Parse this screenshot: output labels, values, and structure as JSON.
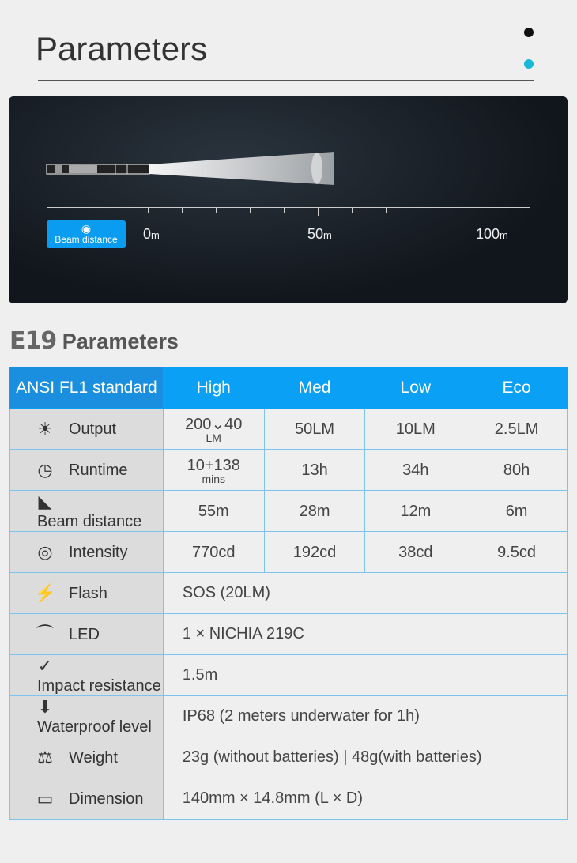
{
  "header": {
    "title": "Parameters",
    "dot_colors": [
      "#111111",
      "#1ab8d8"
    ]
  },
  "hero": {
    "badge_icon": "eye-icon",
    "badge_label": "Beam distance",
    "ticks": [
      "0",
      "50",
      "100"
    ],
    "unit": "m"
  },
  "section": {
    "model": "E19",
    "title": "Parameters"
  },
  "table": {
    "header": [
      "ANSI FL1 standard",
      "High",
      "Med",
      "Low",
      "Eco"
    ],
    "mode_rows": [
      {
        "icon": "output-icon",
        "label": "Output",
        "values": [
          {
            "main": "200⌄40",
            "sub": "LM"
          },
          {
            "main": "50LM"
          },
          {
            "main": "10LM"
          },
          {
            "main": "2.5LM"
          }
        ]
      },
      {
        "icon": "clock-icon",
        "label": "Runtime",
        "values": [
          {
            "main": "10+138",
            "sub": "mins"
          },
          {
            "main": "13h"
          },
          {
            "main": "34h"
          },
          {
            "main": "80h"
          }
        ]
      },
      {
        "icon": "beam-icon",
        "label": "Beam distance",
        "values": [
          {
            "main": "55m"
          },
          {
            "main": "28m"
          },
          {
            "main": "12m"
          },
          {
            "main": "6m"
          }
        ]
      },
      {
        "icon": "intensity-icon",
        "label": "Intensity",
        "values": [
          {
            "main": "770cd"
          },
          {
            "main": "192cd"
          },
          {
            "main": "38cd"
          },
          {
            "main": "9.5cd"
          }
        ]
      }
    ],
    "spec_rows": [
      {
        "icon": "flash-icon",
        "label": "Flash",
        "value": "SOS (20LM)"
      },
      {
        "icon": "led-icon",
        "label": "LED",
        "value": "1 × NICHIA 219C"
      },
      {
        "icon": "impact-icon",
        "label": "Impact resistance",
        "value": "1.5m"
      },
      {
        "icon": "waterproof-icon",
        "label": "Waterproof level",
        "value": "IP68 (2 meters underwater for 1h)"
      },
      {
        "icon": "scale-icon",
        "label": "Weight",
        "value": "23g (without batteries) | 48g(with batteries)"
      },
      {
        "icon": "ruler-icon",
        "label": "Dimension",
        "value": "140mm × 14.8mm (L × D)"
      }
    ]
  }
}
